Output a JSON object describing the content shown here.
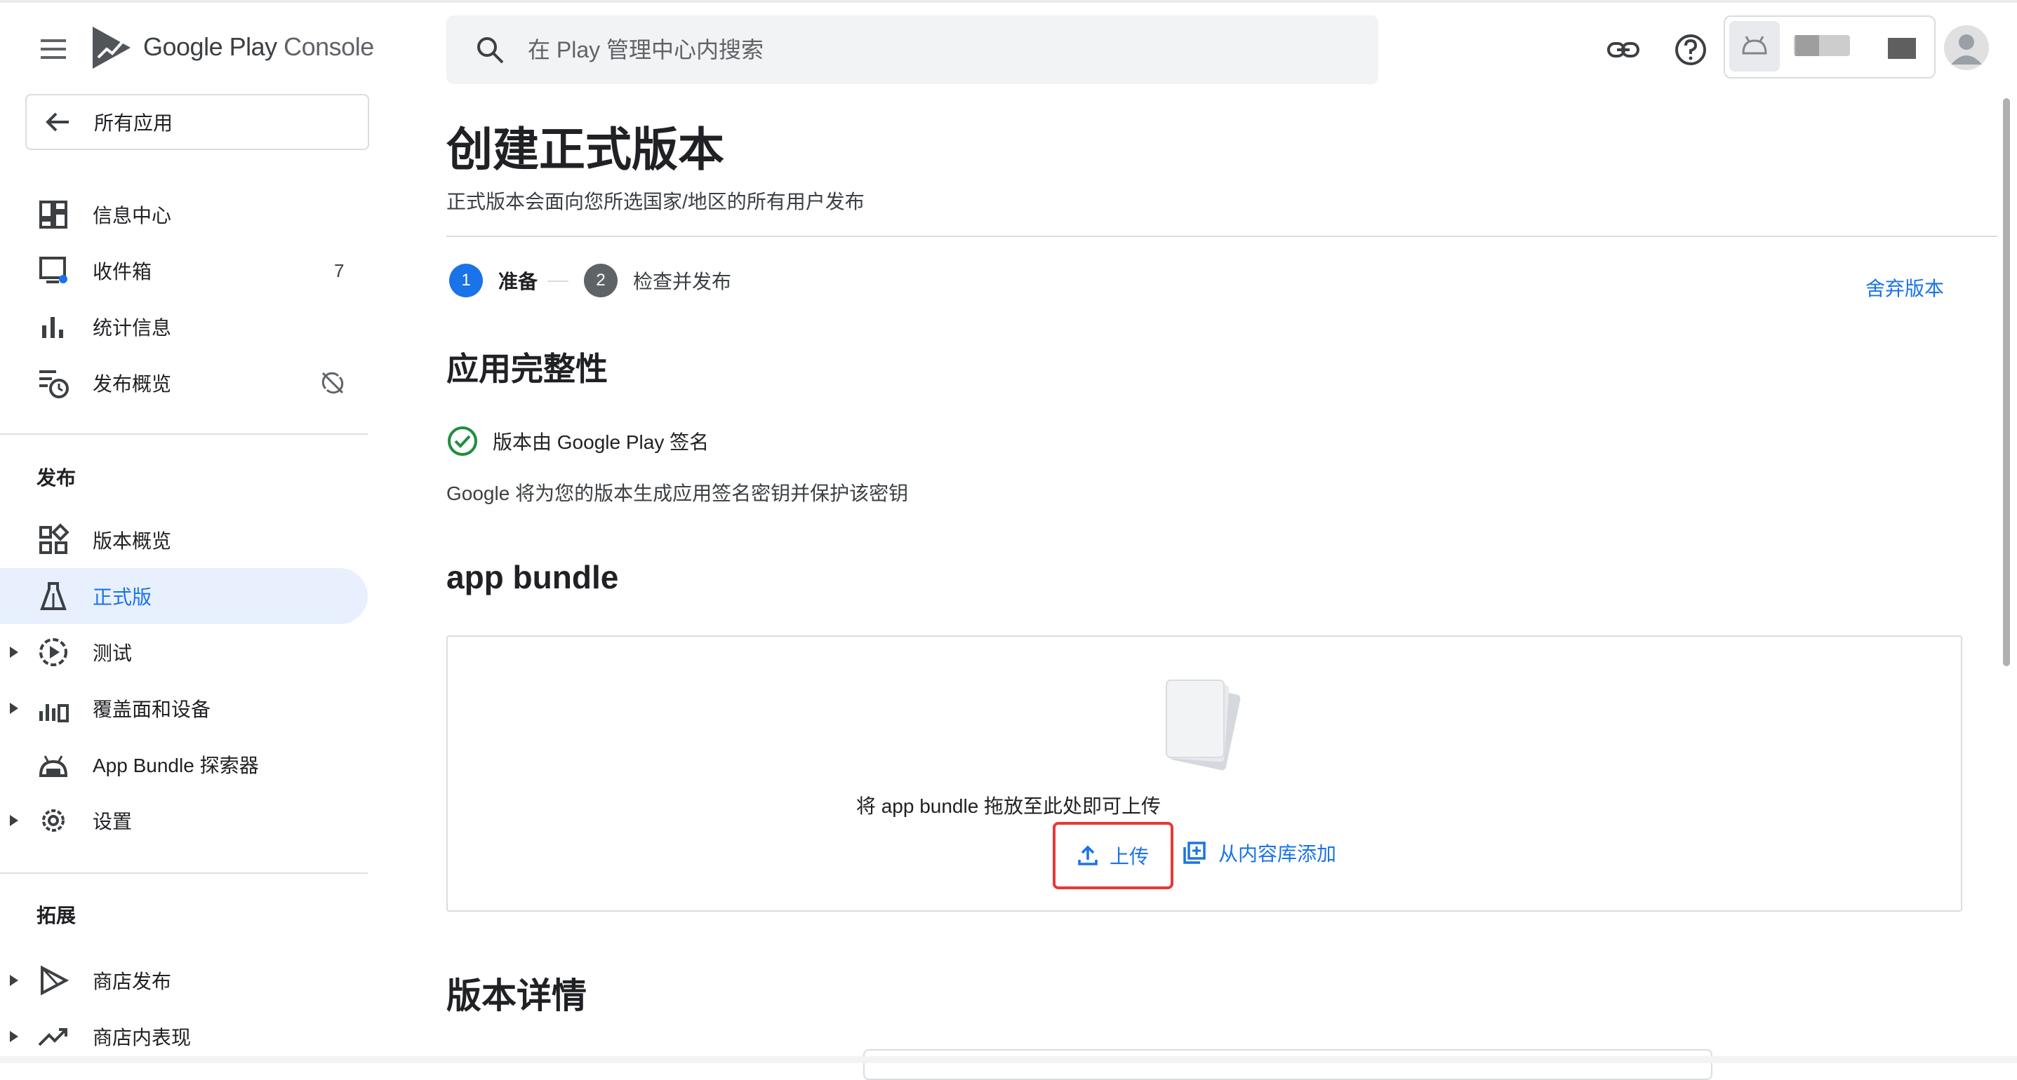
{
  "app": {
    "logo_google_play": "Google Play",
    "logo_console": " Console"
  },
  "search": {
    "placeholder": "在 Play 管理中心内搜索"
  },
  "header_icons": [
    "link-icon",
    "help-icon",
    "android-icon",
    "avatar-icon"
  ],
  "sidebar": {
    "all_apps": "所有应用",
    "items_top": [
      {
        "label": "信息中心"
      },
      {
        "label": "收件箱",
        "badge": "7"
      },
      {
        "label": "统计信息"
      },
      {
        "label": "发布概览"
      }
    ],
    "section_release": "发布",
    "items_release": [
      {
        "label": "版本概览"
      },
      {
        "label": "正式版"
      },
      {
        "label": "测试"
      },
      {
        "label": "覆盖面和设备"
      },
      {
        "label": "App Bundle 探索器"
      },
      {
        "label": "设置"
      }
    ],
    "section_grow": "拓展",
    "items_grow": [
      {
        "label": "商店发布"
      },
      {
        "label": "商店内表现"
      }
    ]
  },
  "main": {
    "title": "创建正式版本",
    "subtitle": "正式版本会面向您所选国家/地区的所有用户发布",
    "steps": [
      {
        "num": "1",
        "label": "准备"
      },
      {
        "num": "2",
        "label": "检查并发布"
      }
    ],
    "discard": "舍弃版本",
    "integrity": {
      "heading": "应用完整性",
      "status": "版本由 Google Play 签名",
      "description": "Google 将为您的版本生成应用签名密钥并保护该密钥"
    },
    "bundle": {
      "heading": "app bundle",
      "drop_text": "将 app bundle 拖放至此处即可上传",
      "upload": "上传",
      "add_from_library": "从内容库添加"
    },
    "details_heading": "版本详情"
  },
  "colors": {
    "accent": "#1a73e8",
    "highlight": "#e53935",
    "active_bg": "#e8f0fe"
  }
}
